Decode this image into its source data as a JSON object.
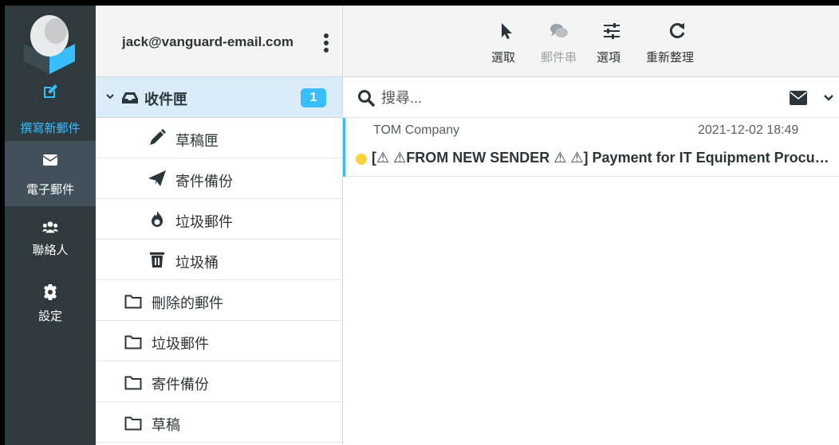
{
  "nav": {
    "compose": "撰寫新郵件",
    "mail": "電子郵件",
    "contacts": "聯絡人",
    "settings": "設定"
  },
  "account": {
    "email": "jack@vanguard-email.com"
  },
  "folders": {
    "inbox": {
      "label": "收件匣",
      "unread": "1"
    },
    "drafts_sub": "草稿匣",
    "sent_sub": "寄件備份",
    "junk_sub": "垃圾郵件",
    "trash_sub": "垃圾桶",
    "deleted": "刪除的郵件",
    "junk": "垃圾郵件",
    "sent": "寄件備份",
    "drafts": "草稿"
  },
  "toolbar": {
    "select": "選取",
    "threads": "郵件串",
    "options": "選項",
    "refresh": "重新整理"
  },
  "search": {
    "placeholder": "搜尋..."
  },
  "messages": [
    {
      "from": "TOM Company",
      "date": "2021-12-02 18:49",
      "subject": "[⚠ ⚠FROM NEW SENDER ⚠ ⚠] Payment for IT Equipment Procurement",
      "unread": true
    }
  ],
  "colors": {
    "nav_bg": "#2f3a3f",
    "accent": "#37beff",
    "selected_folder": "#d9ecf8",
    "unread_dot": "#ffd13f"
  }
}
